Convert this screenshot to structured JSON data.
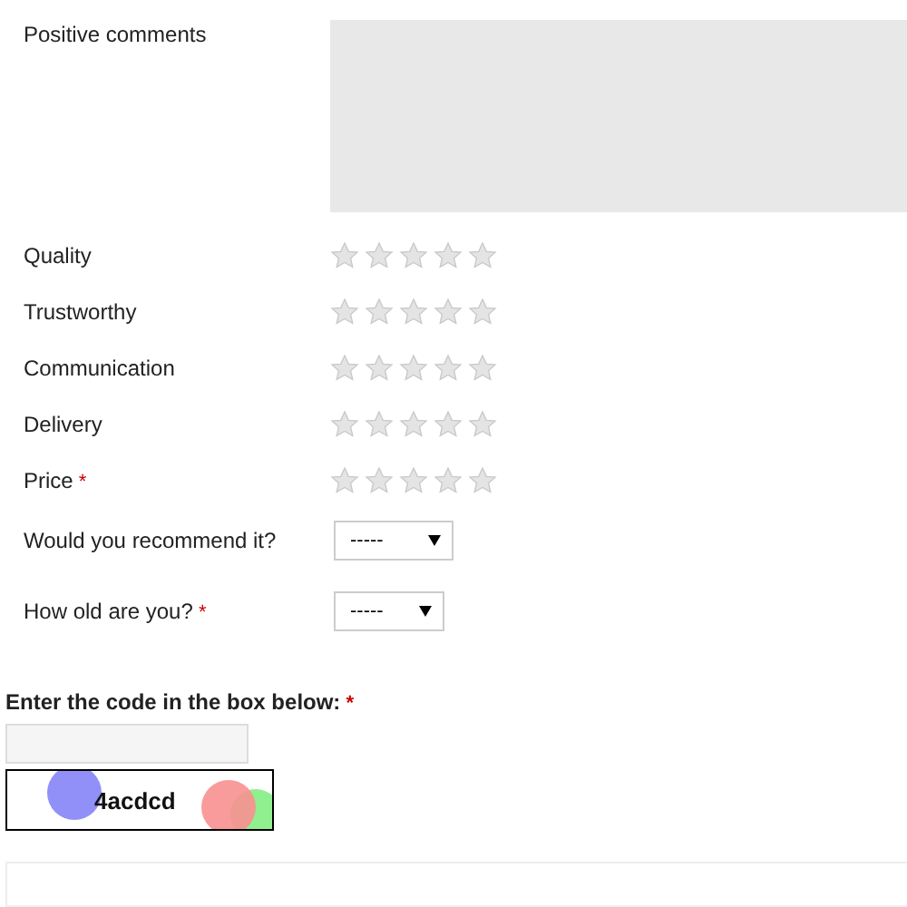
{
  "comments": {
    "label": "Positive comments"
  },
  "ratings": [
    {
      "label": "Quality",
      "required": false,
      "stars": 0
    },
    {
      "label": "Trustworthy",
      "required": false,
      "stars": 0
    },
    {
      "label": "Communication",
      "required": false,
      "stars": 0
    },
    {
      "label": "Delivery",
      "required": false,
      "stars": 0
    },
    {
      "label": "Price",
      "required": true,
      "stars": 0
    }
  ],
  "selects": [
    {
      "label": "Would you recommend it?",
      "required": false,
      "value": "-----"
    },
    {
      "label": "How old are you?",
      "required": true,
      "value": "-----"
    }
  ],
  "captcha": {
    "label": "Enter the code in the box below:",
    "required": true,
    "code": "4acdcd"
  },
  "required_mark": "*"
}
